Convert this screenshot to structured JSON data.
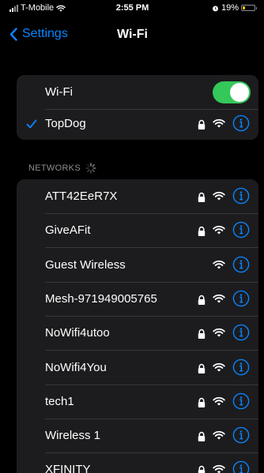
{
  "status_bar": {
    "carrier": "T-Mobile",
    "time": "2:55 PM",
    "battery_percent": "19%",
    "battery_level": 0.19
  },
  "nav": {
    "back_label": "Settings",
    "title": "Wi-Fi"
  },
  "wifi_toggle": {
    "label": "Wi-Fi",
    "on": true
  },
  "connected_network": {
    "name": "TopDog",
    "secured": true
  },
  "networks_section": {
    "header": "NETWORKS"
  },
  "networks": [
    {
      "name": "ATT42EeR7X",
      "secured": true
    },
    {
      "name": "GiveAFit",
      "secured": true
    },
    {
      "name": "Guest Wireless",
      "secured": false
    },
    {
      "name": "Mesh-971949005765",
      "secured": true
    },
    {
      "name": "NoWifi4utoo",
      "secured": true
    },
    {
      "name": "NoWifi4You",
      "secured": true
    },
    {
      "name": "tech1",
      "secured": true
    },
    {
      "name": "Wireless 1",
      "secured": true
    },
    {
      "name": "XFINITY",
      "secured": true
    }
  ],
  "colors": {
    "accent": "#0a84ff",
    "toggle_on": "#34c759",
    "battery_low": "#ffcc00",
    "cell_bg": "#1c1c1e"
  },
  "icons": {
    "back": "chevron-left-icon",
    "lock": "lock-icon",
    "wifi": "wifi-icon",
    "info": "info-icon",
    "spinner": "activity-spinner-icon"
  }
}
